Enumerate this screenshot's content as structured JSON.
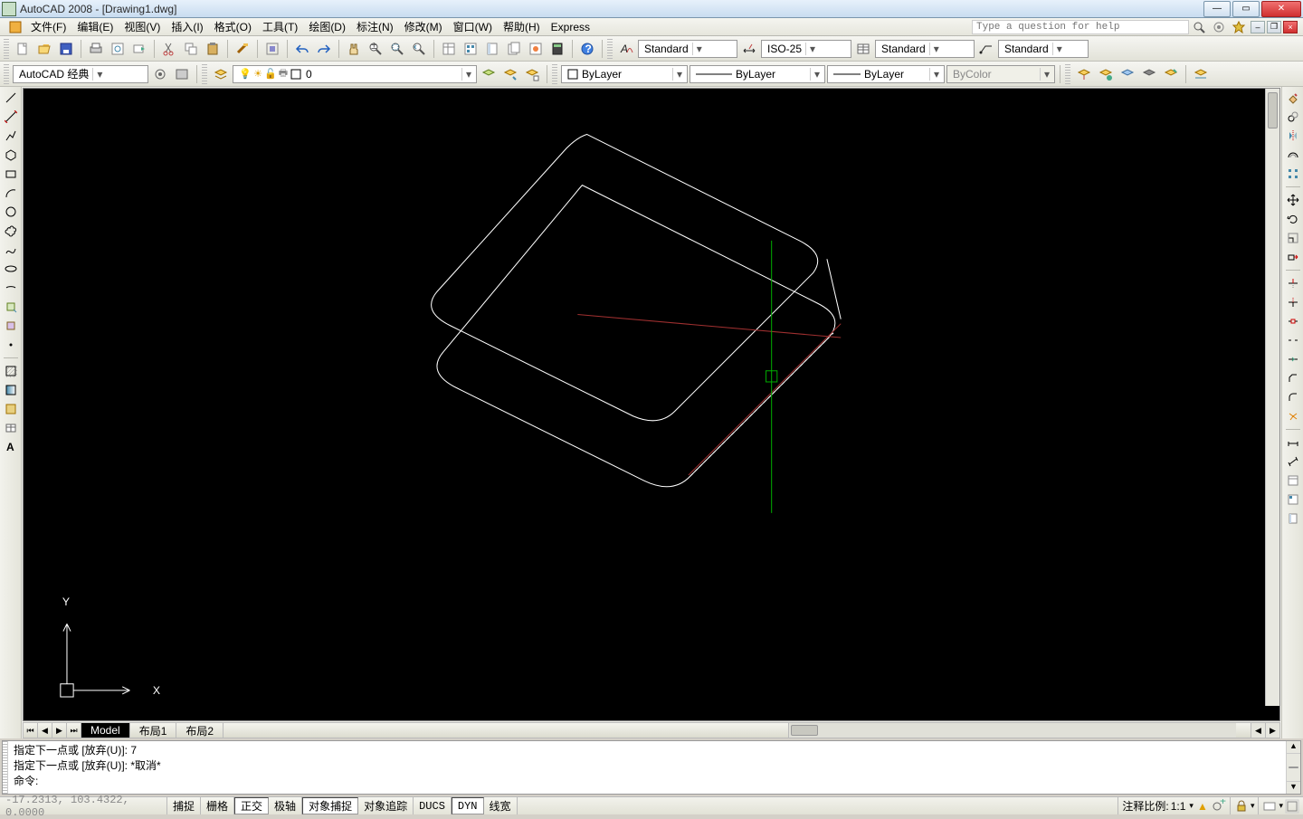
{
  "title": "AutoCAD 2008 - [Drawing1.dwg]",
  "help_placeholder": "Type a question for help",
  "menus": [
    "文件(F)",
    "编辑(E)",
    "视图(V)",
    "插入(I)",
    "格式(O)",
    "工具(T)",
    "绘图(D)",
    "标注(N)",
    "修改(M)",
    "窗口(W)",
    "帮助(H)",
    "Express"
  ],
  "workspace_combo": "AutoCAD 经典",
  "style_dropdowns": {
    "text_style": "Standard",
    "dim_style": "ISO-25",
    "table_style": "Standard",
    "mleader_style": "Standard"
  },
  "layer_dropdown": "0",
  "prop_dropdowns": {
    "color": "ByLayer",
    "linetype": "ByLayer",
    "lineweight": "ByLayer",
    "plotstyle": "ByColor"
  },
  "tabs": {
    "model": "Model",
    "layout1": "布局1",
    "layout2": "布局2"
  },
  "cmd_history": [
    "指定下一点或 [放弃(U)]: 7",
    "指定下一点或 [放弃(U)]: *取消*",
    "命令:"
  ],
  "status": {
    "coords": "-17.2313, 103.4322, 0.0000",
    "toggles": [
      "捕捉",
      "栅格",
      "正交",
      "极轴",
      "对象捕捉",
      "对象追踪",
      "DUCS",
      "DYN",
      "线宽"
    ],
    "anno_label": "注释比例:",
    "anno_scale": "1:1"
  },
  "ucs_labels": {
    "x": "X",
    "y": "Y"
  }
}
